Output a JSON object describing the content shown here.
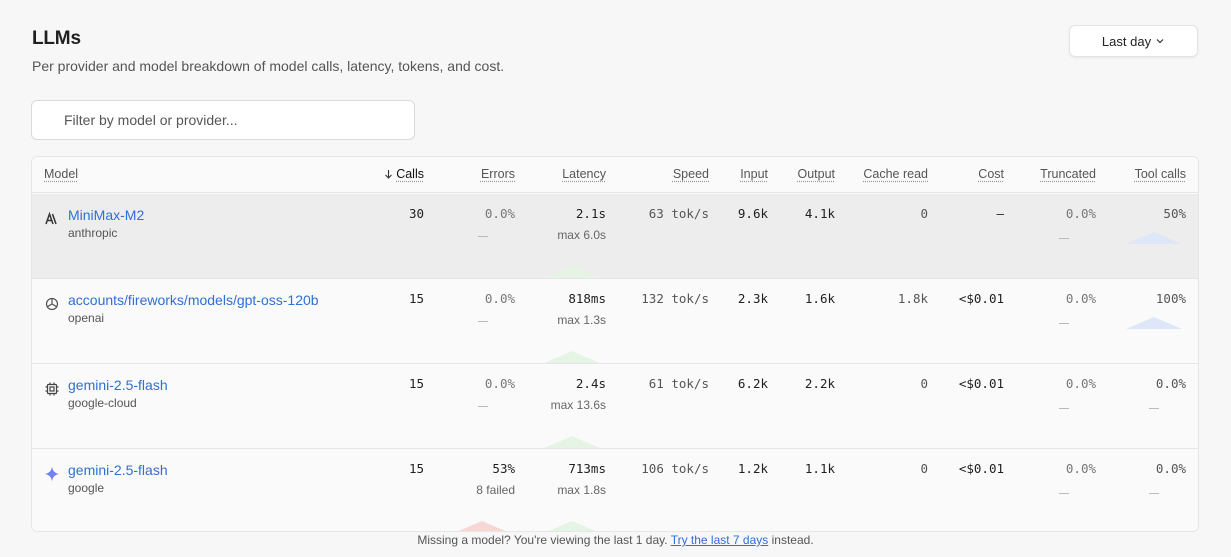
{
  "header": {
    "title": "LLMs",
    "subtitle": "Per provider and model breakdown of model calls, latency, tokens, and cost.",
    "range_label": "Last day"
  },
  "filter": {
    "placeholder": "Filter by model or provider..."
  },
  "columns": {
    "model": "Model",
    "calls": "Calls",
    "errors": "Errors",
    "latency": "Latency",
    "speed": "Speed",
    "input": "Input",
    "output": "Output",
    "cache_read": "Cache read",
    "cost": "Cost",
    "truncated": "Truncated",
    "tool_calls": "Tool calls"
  },
  "rows": [
    {
      "model": "MiniMax-M2",
      "provider": "anthropic",
      "icon": "anthropic-icon",
      "calls": "30",
      "errors": "0.0%",
      "errors_sub": "",
      "latency": "2.1s",
      "latency_max": "max 6.0s",
      "speed": "63 tok/s",
      "input": "9.6k",
      "output": "4.1k",
      "cache_read": "0",
      "cost": "–",
      "truncated": "0.0%",
      "tool_calls": "50%"
    },
    {
      "model": "accounts/fireworks/models/gpt-oss-120b",
      "provider": "openai",
      "icon": "openai-icon",
      "calls": "15",
      "errors": "0.0%",
      "errors_sub": "",
      "latency": "818ms",
      "latency_max": "max 1.3s",
      "speed": "132 tok/s",
      "input": "2.3k",
      "output": "1.6k",
      "cache_read": "1.8k",
      "cost": "<$0.01",
      "truncated": "0.0%",
      "tool_calls": "100%"
    },
    {
      "model": "gemini-2.5-flash",
      "provider": "google-cloud",
      "icon": "chip-icon",
      "calls": "15",
      "errors": "0.0%",
      "errors_sub": "",
      "latency": "2.4s",
      "latency_max": "max 13.6s",
      "speed": "61 tok/s",
      "input": "6.2k",
      "output": "2.2k",
      "cache_read": "0",
      "cost": "<$0.01",
      "truncated": "0.0%",
      "tool_calls": "0.0%"
    },
    {
      "model": "gemini-2.5-flash",
      "provider": "google",
      "icon": "gemini-sparkle-icon",
      "calls": "15",
      "errors": "53%",
      "errors_sub": "8 failed",
      "latency": "713ms",
      "latency_max": "max 1.8s",
      "speed": "106 tok/s",
      "input": "1.2k",
      "output": "1.1k",
      "cache_read": "0",
      "cost": "<$0.01",
      "truncated": "0.0%",
      "tool_calls": "0.0%"
    }
  ],
  "footer": {
    "prefix": "Missing a model? You're viewing the last 1 day.",
    "link": "Try the last 7 days",
    "suffix": "instead."
  },
  "colors": {
    "link": "#2f6fd6",
    "latency_spark": "#bfe3c0",
    "tool_spark": "#bcd0f0",
    "error_spark": "#f2b3b3"
  }
}
